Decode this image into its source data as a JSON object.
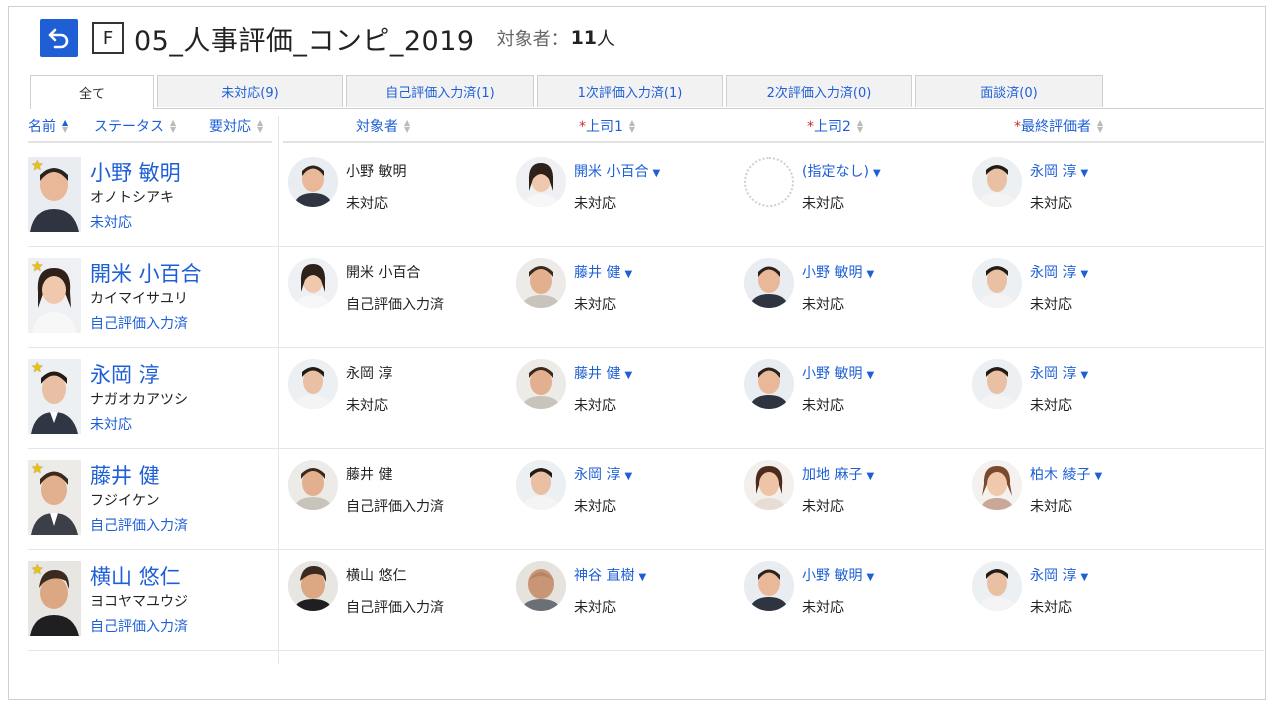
{
  "header": {
    "title": "05_人事評価_コンピ_2019",
    "form_letter": "F",
    "count_label": "対象者：",
    "count_value": "11",
    "count_unit": "人"
  },
  "tabs": [
    {
      "label": "全て"
    },
    {
      "label": "未対応(9)"
    },
    {
      "label": "自己評価入力済(1)"
    },
    {
      "label": "1次評価入力済(1)"
    },
    {
      "label": "2次評価入力済(0)"
    },
    {
      "label": "面談済(0)"
    }
  ],
  "columns": {
    "name": "名前",
    "status": "ステータス",
    "action": "要対応",
    "target": "対象者",
    "boss1": "上司1",
    "boss2": "上司2",
    "final": "最終評価者",
    "required_mark": "*"
  },
  "rows": [
    {
      "name": "小野 敏明",
      "kana": "オノトシアキ",
      "status": "未対応",
      "target": {
        "name": "小野 敏明",
        "status": "未対応"
      },
      "boss1": {
        "name": "開米 小百合",
        "status": "未対応"
      },
      "boss2": {
        "name": "(指定なし)",
        "status": "未対応"
      },
      "final": {
        "name": "永岡 淳",
        "status": "未対応"
      }
    },
    {
      "name": "開米 小百合",
      "kana": "カイマイサユリ",
      "status": "自己評価入力済",
      "target": {
        "name": "開米 小百合",
        "status": "自己評価入力済"
      },
      "boss1": {
        "name": "藤井 健",
        "status": "未対応"
      },
      "boss2": {
        "name": "小野 敏明",
        "status": "未対応"
      },
      "final": {
        "name": "永岡 淳",
        "status": "未対応"
      }
    },
    {
      "name": "永岡 淳",
      "kana": "ナガオカアツシ",
      "status": "未対応",
      "target": {
        "name": "永岡 淳",
        "status": "未対応"
      },
      "boss1": {
        "name": "藤井 健",
        "status": "未対応"
      },
      "boss2": {
        "name": "小野 敏明",
        "status": "未対応"
      },
      "final": {
        "name": "永岡 淳",
        "status": "未対応"
      }
    },
    {
      "name": "藤井 健",
      "kana": "フジイケン",
      "status": "自己評価入力済",
      "target": {
        "name": "藤井 健",
        "status": "自己評価入力済"
      },
      "boss1": {
        "name": "永岡 淳",
        "status": "未対応"
      },
      "boss2": {
        "name": "加地 麻子",
        "status": "未対応"
      },
      "final": {
        "name": "柏木 綾子",
        "status": "未対応"
      }
    },
    {
      "name": "横山 悠仁",
      "kana": "ヨコヤマユウジ",
      "status": "自己評価入力済",
      "target": {
        "name": "横山 悠仁",
        "status": "自己評価入力済"
      },
      "boss1": {
        "name": "神谷 直樹",
        "status": "未対応"
      },
      "boss2": {
        "name": "小野 敏明",
        "status": "未対応"
      },
      "final": {
        "name": "永岡 淳",
        "status": "未対応"
      }
    }
  ],
  "icons": {
    "back": "back-arrow-icon",
    "sort": "sort-icon",
    "caret": "caret-down-icon",
    "star": "star-icon"
  },
  "colors": {
    "accent": "#1e5fd6",
    "required": "#d12b2b",
    "star": "#f2c200"
  }
}
